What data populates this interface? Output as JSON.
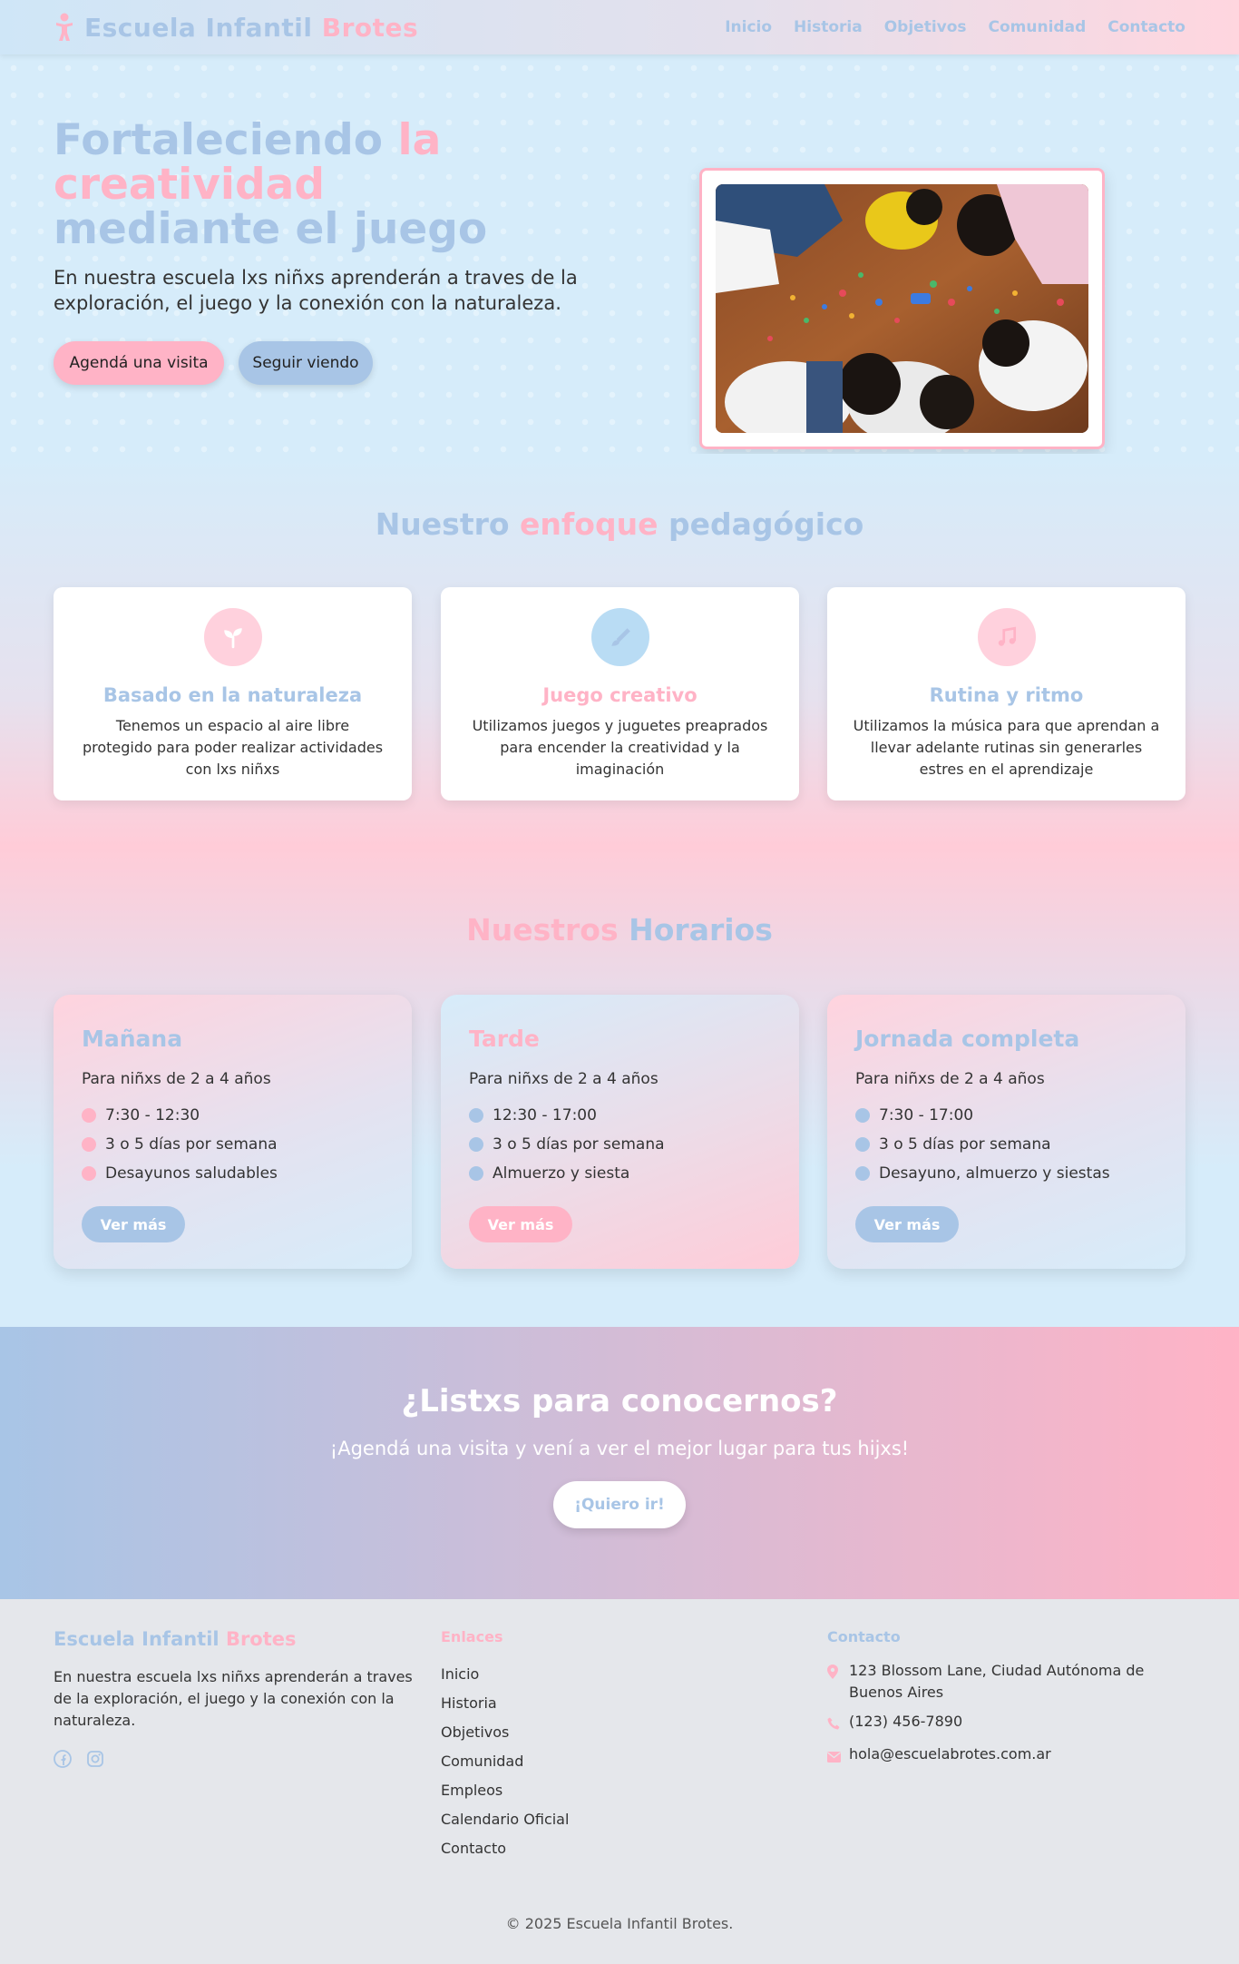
{
  "nav": {
    "brand_part1": "Escuela Infantil",
    "brand_part2": "Brotes",
    "links": [
      "Inicio",
      "Historia",
      "Objetivos",
      "Comunidad",
      "Contacto"
    ]
  },
  "hero": {
    "title_part1": "Fortaleciendo",
    "title_part2": "la creatividad",
    "title_part3": "mediante el juego",
    "subtitle": "En nuestra escuela lxs niñxs aprenderán a traves de la exploración, el juego y la conexión con la naturaleza.",
    "btn_visit": "Agendá una visita",
    "btn_more": "Seguir viendo"
  },
  "approach": {
    "title_part1": "Nuestro",
    "title_part2": "enfoque",
    "title_part3": "pedagógico",
    "cards": [
      {
        "icon": "seedling-icon",
        "title": "Basado en la naturaleza",
        "text": "Tenemos un espacio al aire libre protegido para poder realizar actividades con lxs niñxs"
      },
      {
        "icon": "paintbrush-icon",
        "title": "Juego creativo",
        "text": "Utilizamos juegos y juguetes preaprados para encender la creatividad y la imaginación"
      },
      {
        "icon": "music-icon",
        "title": "Rutina y ritmo",
        "text": "Utilizamos la música para que aprendan a llevar adelante rutinas sin generarles estres en el aprendizaje"
      }
    ]
  },
  "schedule": {
    "title_part1": "Nuestros",
    "title_part2": "Horarios",
    "cards": [
      {
        "title": "Mañana",
        "age": "Para niñxs de 2 a 4 años",
        "items": [
          "7:30 - 12:30",
          "3 o 5 días por semana",
          "Desayunos saludables"
        ],
        "button": "Ver más"
      },
      {
        "title": "Tarde",
        "age": "Para niñxs de 2 a 4 años",
        "items": [
          "12:30 - 17:00",
          "3 o 5 días por semana",
          "Almuerzo y siesta"
        ],
        "button": "Ver más"
      },
      {
        "title": "Jornada completa",
        "age": "Para niñxs de 2 a 4 años",
        "items": [
          "7:30 - 17:00",
          "3 o 5 días por semana",
          "Desayuno, almuerzo y siestas"
        ],
        "button": "Ver más"
      }
    ]
  },
  "cta": {
    "title": "¿Listxs para conocernos?",
    "subtitle": "¡Agendá una visita y vení a ver el mejor lugar para tus hijxs!",
    "button": "¡Quiero ir!"
  },
  "footer": {
    "brand_part1": "Escuela Infantil",
    "brand_part2": "Brotes",
    "description": "En nuestra escuela lxs niñxs aprenderán a traves de la exploración, el juego y la conexión con la naturaleza.",
    "links_title": "Enlaces",
    "links": [
      "Inicio",
      "Historia",
      "Objetivos",
      "Comunidad",
      "Empleos",
      "Calendario Oficial",
      "Contacto"
    ],
    "contact_title": "Contacto",
    "address": "123 Blossom Lane, Ciudad Autónoma de Buenos Aires",
    "phone": "(123) 456-7890",
    "email": "hola@escuelabrotes.com.ar",
    "copyright": "© 2025 Escuela Infantil Brotes."
  },
  "colors": {
    "pink": "#ffb3c6",
    "blue": "#a8c5e6",
    "sky": "#d6ecfa"
  }
}
